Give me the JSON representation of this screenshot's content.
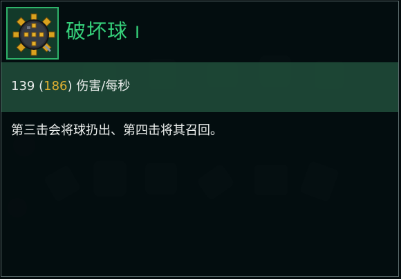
{
  "item": {
    "icon": "spiked-ball-icon",
    "name": "破坏球",
    "tier": "I"
  },
  "stats": {
    "base_damage": "139",
    "open_paren": "(",
    "upgraded_damage": "186",
    "close_paren": ")",
    "unit": "伤害/每秒"
  },
  "description": "第三击会将球扔出、第四击将其召回。",
  "colors": {
    "title": "#35d07a",
    "upgraded_value": "#e0b032",
    "icon_border": "#2fb36a",
    "stat_band": "#245440"
  }
}
